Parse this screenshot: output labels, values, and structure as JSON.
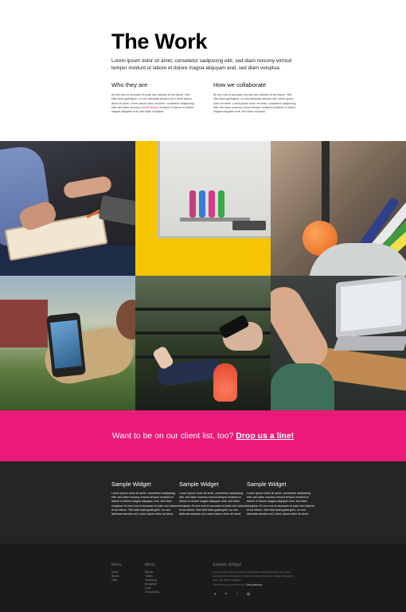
{
  "intro": {
    "title": "The Work",
    "lead": "Lorem ipsum dolor sit amet, consetetur sadipscing elitr, sed diam nonumy eirmod tempor invidunt ut labore et dolore magna aliquyam erat, sed diam voluptua.",
    "col1": {
      "heading": "Who they are",
      "text_a": "At vero eos et accusam et justo duo dolores et ea rebum. Stet clita kasd gubergren, no sea takimata sanctus est Lorem ipsum dolor sit amet. Lorem ipsum dolor sit amet, consetetur sadipscing elitr, sed diam nonumy ",
      "highlight": "eirmod tempor",
      "text_b": " invidunt ut labore et dolore magna aliquyam erat, sed diam voluptua."
    },
    "col2": {
      "heading": "How we collaborate",
      "text": "At vero eos et accusam et justo duo dolores et ea rebum. Stet clita kasd gubergren, no sea takimata sanctus est Lorem ipsum dolor sit amet. Lorem ipsum dolor sit amet, consetetur sadipscing elitr, sed diam nonumy eirmod tempor invidunt ut labore et dolore magna aliquyam erat, sed diam voluptua."
    }
  },
  "gallery": {
    "items": [
      "man-writing-notebook",
      "whiteboard-markers",
      "markers-in-cup",
      "phone-in-hand",
      "bench-phone-drink",
      "laptop-on-table"
    ]
  },
  "cta": {
    "text": "Want to be on our client list, too?",
    "link": "Drop us a line!",
    "color": "#ec1a78"
  },
  "widgets": [
    {
      "title": "Sample Widget",
      "text": "Lorem ipsum dolor sit amet, consetetur sadipscing elitr, sed diam nonumy eirmod tempor invidunt ut labore et dolore magna aliquyam erat, sed diam voluptua. At vero eos et accusam et justo duo dolores et ea rebum. Stet clita kasd gubergren, no sea takimata sanctus est Lorem ipsum dolor sit amet."
    },
    {
      "title": "Sample Widget",
      "text": "Lorem ipsum dolor sit amet, consetetur sadipscing elitr, sed diam nonumy eirmod tempor invidunt ut labore et dolore magna aliquyam erat, sed diam voluptua. At vero eos et accusam et justo duo dolores et ea rebum. Stet clita kasd gubergren, no sea takimata sanctus est Lorem ipsum dolor sit amet."
    },
    {
      "title": "Sample Widget",
      "text": "Lorem ipsum dolor sit amet, consetetur sadipscing elitr, sed diam nonumy eirmod tempor invidunt ut labore et dolore magna aliquyam erat, sed diam voluptua. At vero eos et accusam et justo duo dolores et ea rebum. Stet clita kasd gubergren, no sea takimata sanctus est Lorem ipsum dolor sit amet."
    }
  ],
  "footer": {
    "menu1": {
      "title": "Menu",
      "items": [
        "Home",
        "Books",
        "Jobs"
      ]
    },
    "menu2": {
      "title": "Menu",
      "items": [
        "Hipster",
        "Twitter",
        "Facebook",
        "Bringing it",
        "Links",
        "Geocaching"
      ]
    },
    "widget": {
      "title": "Sample Widget",
      "text": "Lorem ipsum dolor sit amet, consetetur sadipscing elitr, sed diam nonumy eirmod tempor invidunt ut labore et dolore magna aliquyam erat, sed diam voluptua.",
      "credit_prefix": "Theme by you, powered by ",
      "credit_link": "Templatehaus"
    },
    "social_icons": [
      "github-icon",
      "twitter-icon",
      "facebook-icon",
      "apple-icon"
    ]
  }
}
